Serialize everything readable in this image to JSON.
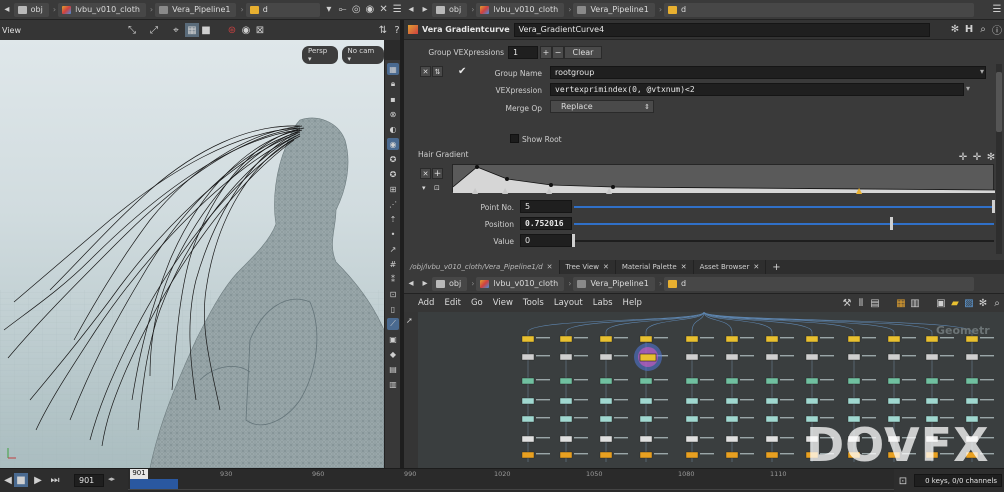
{
  "left_pathbar": {
    "crumbs": [
      {
        "label": "obj",
        "icon": "obj-icon"
      },
      {
        "label": "lvbu_v010_cloth",
        "icon": "geo-icon"
      },
      {
        "label": "Vera_Pipeline1",
        "icon": "dopnet-icon"
      },
      {
        "label": "d",
        "icon": "sop-icon"
      }
    ]
  },
  "viewport": {
    "title": "View",
    "camera_mode": "Persp",
    "camera": "No cam"
  },
  "right_pathbar": {
    "crumbs": [
      {
        "label": "obj",
        "icon": "obj-icon"
      },
      {
        "label": "lvbu_v010_cloth",
        "icon": "geo-icon"
      },
      {
        "label": "Vera_Pipeline1",
        "icon": "dopnet-icon"
      },
      {
        "label": "d",
        "icon": "sop-icon"
      }
    ]
  },
  "node_header": {
    "type": "Vera Gradientcurve",
    "name": "Vera_GradientCurve4",
    "help_icon": "H"
  },
  "params": {
    "group_vexpressions_label": "Group VEXpressions",
    "group_vexpressions_value": "1",
    "plus_label": "+",
    "minus_label": "−",
    "clear_label": "Clear",
    "group_name_label": "Group Name",
    "group_name_value": "rootgroup",
    "vexpression_label": "VEXpression",
    "vexpression_value": "vertexprimindex(0, @vtxnum)<2",
    "merge_op_label": "Merge Op",
    "merge_op_value": "Replace",
    "show_root_label": "Show Root",
    "hair_gradient_label": "Hair Gradient",
    "point_no_label": "Point No.",
    "point_no_value": "5",
    "position_label": "Position",
    "position_value": "0.752016",
    "position_fraction": 0.752,
    "value_label": "Value",
    "value_value": "0"
  },
  "network_tabs": {
    "path": "/obj/lvbu_v010_cloth/Vera_Pipeline1/d",
    "tabs": [
      "Tree View",
      "Material Palette",
      "Asset Browser"
    ],
    "add_label": "+"
  },
  "network_menu": {
    "items": [
      "Add",
      "Edit",
      "Go",
      "View",
      "Tools",
      "Layout",
      "Labs",
      "Help"
    ]
  },
  "network": {
    "context_label": "Geometr"
  },
  "timeline": {
    "frame": "901",
    "marker": "901",
    "ticks": [
      "930",
      "960",
      "990",
      "1020",
      "1050",
      "1080",
      "1110"
    ],
    "keys_label": "0 keys, 0/0 channels"
  },
  "watermark": "DOVFX"
}
